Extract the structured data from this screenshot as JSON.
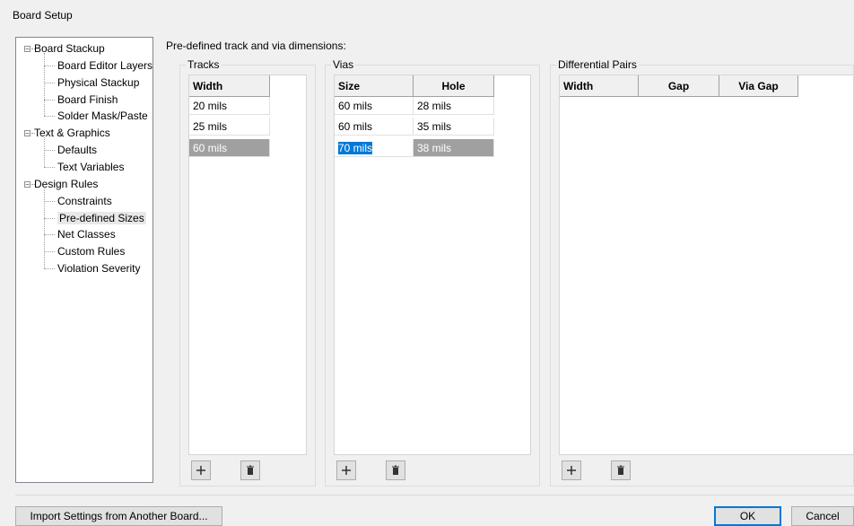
{
  "window": {
    "title": "Board Setup"
  },
  "tree": {
    "items": [
      {
        "label": "Board Stackup",
        "level": 0,
        "expanded": true
      },
      {
        "label": "Board Editor Layers",
        "level": 1
      },
      {
        "label": "Physical Stackup",
        "level": 1
      },
      {
        "label": "Board Finish",
        "level": 1
      },
      {
        "label": "Solder Mask/Paste",
        "level": 1
      },
      {
        "label": "Text & Graphics",
        "level": 0,
        "expanded": true
      },
      {
        "label": "Defaults",
        "level": 1
      },
      {
        "label": "Text Variables",
        "level": 1
      },
      {
        "label": "Design Rules",
        "level": 0,
        "expanded": true
      },
      {
        "label": "Constraints",
        "level": 1
      },
      {
        "label": "Pre-defined Sizes",
        "level": 1,
        "selected": true
      },
      {
        "label": "Net Classes",
        "level": 1
      },
      {
        "label": "Custom Rules",
        "level": 1
      },
      {
        "label": "Violation Severity",
        "level": 1
      }
    ]
  },
  "panel": {
    "heading": "Pre-defined track and via dimensions:",
    "tracks": {
      "label": "Tracks",
      "columns": [
        "Width"
      ],
      "rows": [
        [
          "20 mils"
        ],
        [
          "25 mils"
        ],
        [
          "60 mils"
        ]
      ],
      "selected_row": 2
    },
    "vias": {
      "label": "Vias",
      "columns": [
        "Size",
        "Hole"
      ],
      "rows": [
        [
          "60 mils",
          "28 mils"
        ],
        [
          "60 mils",
          "35 mils"
        ],
        [
          "70 mils",
          "38 mils"
        ]
      ],
      "selected_row": 2,
      "editing_cell": "70 mils"
    },
    "diff_pairs": {
      "label": "Differential Pairs",
      "columns": [
        "Width",
        "Gap",
        "Via Gap"
      ],
      "rows": []
    }
  },
  "footer": {
    "import_label": "Import Settings from Another Board...",
    "ok_label": "OK",
    "cancel_label": "Cancel"
  },
  "icons": {
    "add": "plus-icon",
    "delete": "trash-icon"
  }
}
